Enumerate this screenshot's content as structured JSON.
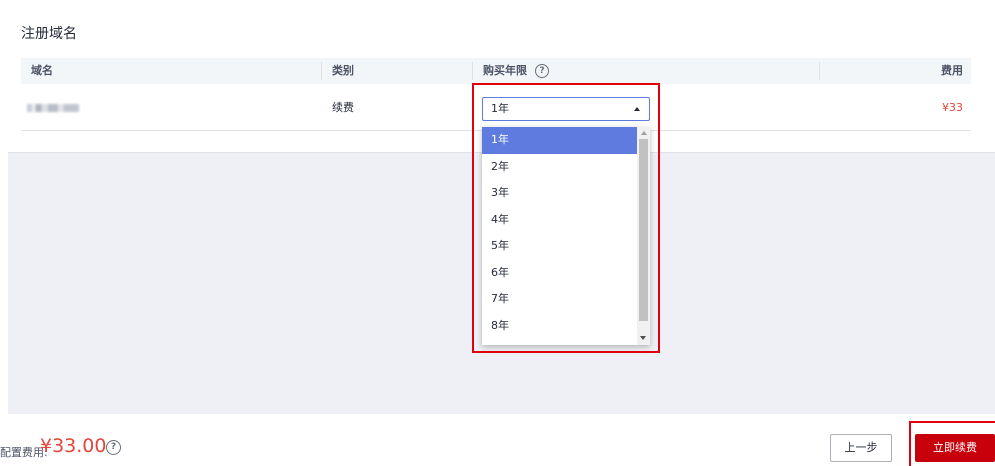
{
  "section": {
    "title": "注册域名"
  },
  "table": {
    "headers": {
      "domain": "域名",
      "type": "类别",
      "years": "购买年限",
      "fee": "费用"
    },
    "rows": [
      {
        "domain": "",
        "type": "续费",
        "fee": "¥33"
      }
    ]
  },
  "years_select": {
    "value": "1年",
    "options": [
      "1年",
      "2年",
      "3年",
      "4年",
      "5年",
      "6年",
      "7年",
      "8年"
    ],
    "selected_index": 0
  },
  "footer": {
    "total_label": "配置费用:",
    "total_amount": "¥33.00",
    "prev_button": "上一步",
    "renew_button": "立即续费"
  },
  "colors": {
    "accent": "#5e7ce0",
    "price": "#e5453b",
    "primary_button": "#c7000b",
    "highlight_box": "#e0000f"
  },
  "icons": {
    "help": "question-circle-icon",
    "select_arrow": "caret-up-icon"
  }
}
